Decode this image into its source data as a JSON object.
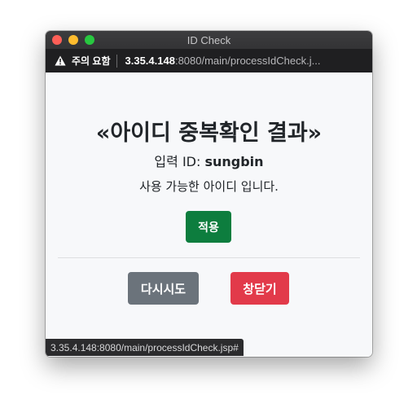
{
  "window": {
    "title": "ID Check"
  },
  "urlbar": {
    "warning_label": "주의 요함",
    "host": "3.35.4.148",
    "path": ":8080/main/processIdCheck.j..."
  },
  "content": {
    "heading": "«아이디 중복확인 결과»",
    "id_label": "입력 ID: ",
    "id_value": "sungbin",
    "message": "사용 가능한 아이디 입니다.",
    "apply_button": "적용",
    "retry_button": "다시시도",
    "close_button": "창닫기"
  },
  "statusbar": {
    "url": "3.35.4.148:8080/main/processIdCheck.jsp#"
  },
  "colors": {
    "apply": "#0d7d3e",
    "retry": "#6b737b",
    "close": "#e23a4a"
  }
}
